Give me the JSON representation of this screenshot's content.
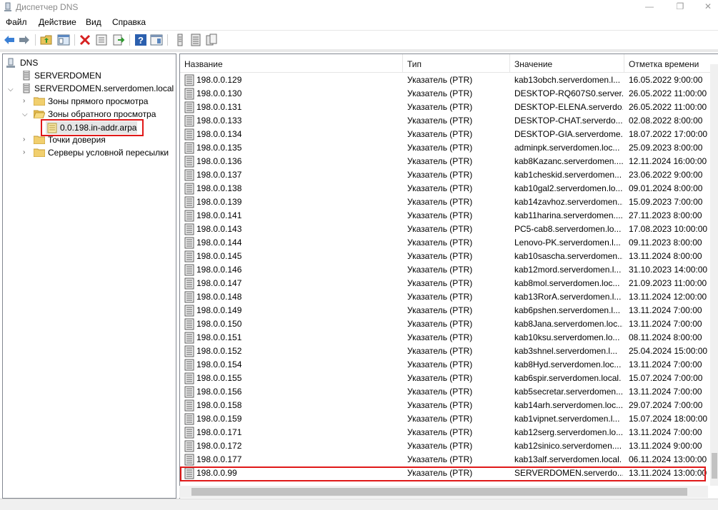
{
  "window": {
    "title": "Диспетчер DNS",
    "minimize": "—",
    "restore": "❐",
    "close": "✕"
  },
  "menu": [
    "Файл",
    "Действие",
    "Вид",
    "Справка"
  ],
  "toolbar_icons": [
    "back-icon",
    "forward-icon",
    "up-folder-icon",
    "show-hide-tree-icon",
    "delete-icon",
    "properties-icon",
    "export-icon",
    "help-icon",
    "console-icon",
    "record-icon",
    "record-list-icon",
    "record-copy-icon"
  ],
  "tree": {
    "root": "DNS",
    "server1": "SERVERDOMEN",
    "server2": "SERVERDOMEN.serverdomen.local",
    "forward": "Зоны прямого просмотра",
    "reverse": "Зоны обратного просмотра",
    "zone": "0.0.198.in-addr.arpa",
    "trust": "Точки доверия",
    "conditional": "Серверы условной пересылки"
  },
  "columns": [
    "Название",
    "Тип",
    "Значение",
    "Отметка времени"
  ],
  "rows": [
    [
      "198.0.0.129",
      "Указатель (PTR)",
      "kab13obch.serverdomen.l...",
      "16.05.2022 9:00:00"
    ],
    [
      "198.0.0.130",
      "Указатель (PTR)",
      "DESKTOP-RQ607S0.server...",
      "26.05.2022 11:00:00"
    ],
    [
      "198.0.0.131",
      "Указатель (PTR)",
      "DESKTOP-ELENA.serverdo...",
      "26.05.2022 11:00:00"
    ],
    [
      "198.0.0.133",
      "Указатель (PTR)",
      "DESKTOP-CHAT.serverdo...",
      "02.08.2022 8:00:00"
    ],
    [
      "198.0.0.134",
      "Указатель (PTR)",
      "DESKTOP-GIA.serverdome...",
      "18.07.2022 17:00:00"
    ],
    [
      "198.0.0.135",
      "Указатель (PTR)",
      "adminpk.serverdomen.loc...",
      "25.09.2023 8:00:00"
    ],
    [
      "198.0.0.136",
      "Указатель (PTR)",
      "kab8Kazanc.serverdomen....",
      "12.11.2024 16:00:00"
    ],
    [
      "198.0.0.137",
      "Указатель (PTR)",
      "kab1cheskid.serverdomen...",
      "23.06.2022 9:00:00"
    ],
    [
      "198.0.0.138",
      "Указатель (PTR)",
      "kab10gal2.serverdomen.lo...",
      "09.01.2024 8:00:00"
    ],
    [
      "198.0.0.139",
      "Указатель (PTR)",
      "kab14zavhoz.serverdomen...",
      "15.09.2023 7:00:00"
    ],
    [
      "198.0.0.141",
      "Указатель (PTR)",
      "kab11harina.serverdomen....",
      "27.11.2023 8:00:00"
    ],
    [
      "198.0.0.143",
      "Указатель (PTR)",
      "PC5-cab8.serverdomen.lo...",
      "17.08.2023 10:00:00"
    ],
    [
      "198.0.0.144",
      "Указатель (PTR)",
      "Lenovo-PK.serverdomen.l...",
      "09.11.2023 8:00:00"
    ],
    [
      "198.0.0.145",
      "Указатель (PTR)",
      "kab10sascha.serverdomen...",
      "13.11.2024 8:00:00"
    ],
    [
      "198.0.0.146",
      "Указатель (PTR)",
      "kab12mord.serverdomen.l...",
      "31.10.2023 14:00:00"
    ],
    [
      "198.0.0.147",
      "Указатель (PTR)",
      "kab8mol.serverdomen.loc...",
      "21.09.2023 11:00:00"
    ],
    [
      "198.0.0.148",
      "Указатель (PTR)",
      "kab13RorA.serverdomen.l...",
      "13.11.2024 12:00:00"
    ],
    [
      "198.0.0.149",
      "Указатель (PTR)",
      "kab6pshen.serverdomen.l...",
      "13.11.2024 7:00:00"
    ],
    [
      "198.0.0.150",
      "Указатель (PTR)",
      "kab8Jana.serverdomen.loc...",
      "13.11.2024 7:00:00"
    ],
    [
      "198.0.0.151",
      "Указатель (PTR)",
      "kab10ksu.serverdomen.lo...",
      "08.11.2024 8:00:00"
    ],
    [
      "198.0.0.152",
      "Указатель (PTR)",
      "kab3shnel.serverdomen.l...",
      "25.04.2024 15:00:00"
    ],
    [
      "198.0.0.154",
      "Указатель (PTR)",
      "kab8Hyd.serverdomen.loc...",
      "13.11.2024 7:00:00"
    ],
    [
      "198.0.0.155",
      "Указатель (PTR)",
      "kab6spir.serverdomen.local.",
      "15.07.2024 7:00:00"
    ],
    [
      "198.0.0.156",
      "Указатель (PTR)",
      "kab5secretar.serverdomen...",
      "13.11.2024 7:00:00"
    ],
    [
      "198.0.0.158",
      "Указатель (PTR)",
      "kab14arh.serverdomen.loc...",
      "29.07.2024 7:00:00"
    ],
    [
      "198.0.0.159",
      "Указатель (PTR)",
      "kab1vipnet.serverdomen.l...",
      "15.07.2024 18:00:00"
    ],
    [
      "198.0.0.171",
      "Указатель (PTR)",
      "kab12serg.serverdomen.lo...",
      "13.11.2024 7:00:00"
    ],
    [
      "198.0.0.172",
      "Указатель (PTR)",
      "kab12sinico.serverdomen....",
      "13.11.2024 9:00:00"
    ],
    [
      "198.0.0.177",
      "Указатель (PTR)",
      "kab13alf.serverdomen.local.",
      "06.11.2024 13:00:00"
    ],
    [
      "198.0.0.99",
      "Указатель (PTR)",
      "SERVERDOMEN.serverdo...",
      "13.11.2024 13:00:00"
    ]
  ],
  "colors": {
    "highlight": "#e01818",
    "border": "#828790"
  }
}
